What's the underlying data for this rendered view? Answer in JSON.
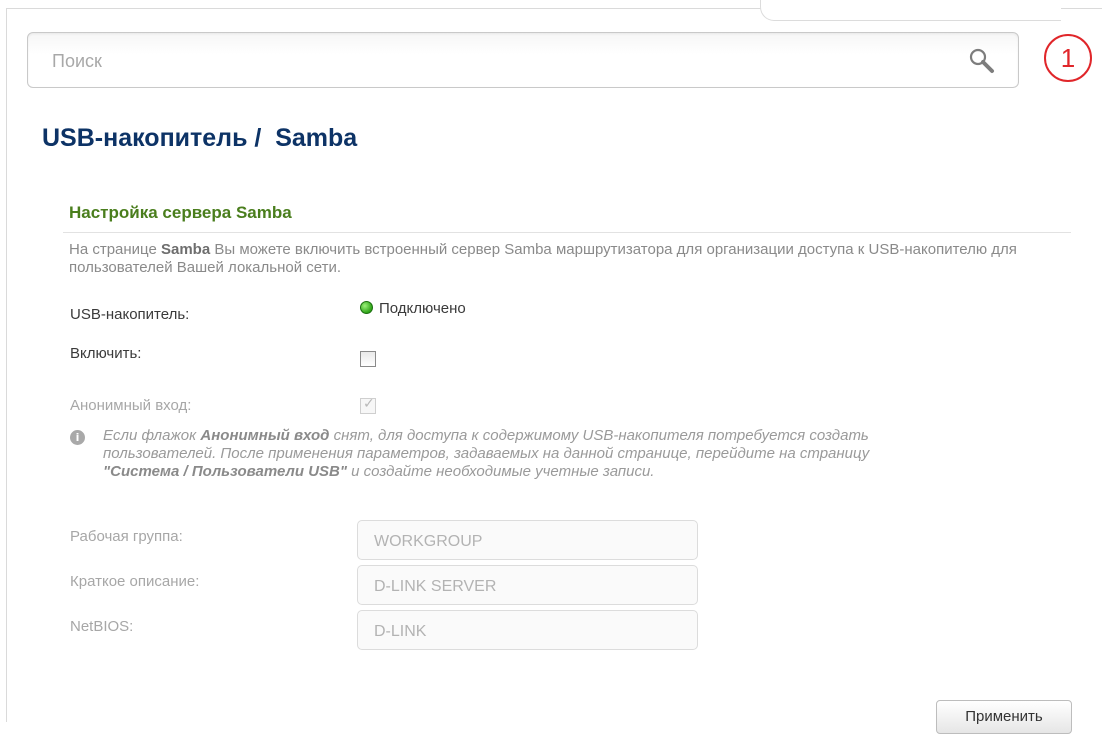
{
  "header": {
    "search_placeholder": "Поиск",
    "search_icon": "magnifier-icon",
    "notification_count": "1"
  },
  "page": {
    "title": "USB-накопитель /  Samba"
  },
  "section": {
    "title": "Настройка сервера Samba",
    "desc_prefix": "На странице ",
    "desc_bold": "Samba",
    "desc_suffix": " Вы можете включить встроенный сервер Samba маршрутизатора для организации доступа к USB-накопителю для пользователей Вашей локальной сети."
  },
  "usb": {
    "label": "USB-накопитель:",
    "status": "Подключено",
    "status_color": "#2ea317"
  },
  "enable": {
    "label": "Включить:",
    "checked": false
  },
  "anonymous": {
    "label": "Анонимный вход:",
    "checked": true,
    "disabled": true
  },
  "info": {
    "icon": "info-icon",
    "part1": "Если флажок ",
    "bold1": "Анонимный вход",
    "part2": " снят, для доступа к содержимому USB-накопителя потребуется создать пользователей. После применения параметров, задаваемых на данной странице, перейдите на страницу ",
    "bold2": "\"Система / Пользователи USB\"",
    "part3": " и создайте необходимые учетные записи."
  },
  "fields": {
    "workgroup_label": "Рабочая группа:",
    "workgroup_value": "WORKGROUP",
    "description_label": "Краткое описание:",
    "description_value": "D-LINK SERVER",
    "netbios_label": "NetBIOS:",
    "netbios_value": "D-LINK"
  },
  "actions": {
    "apply_label": "Применить"
  }
}
